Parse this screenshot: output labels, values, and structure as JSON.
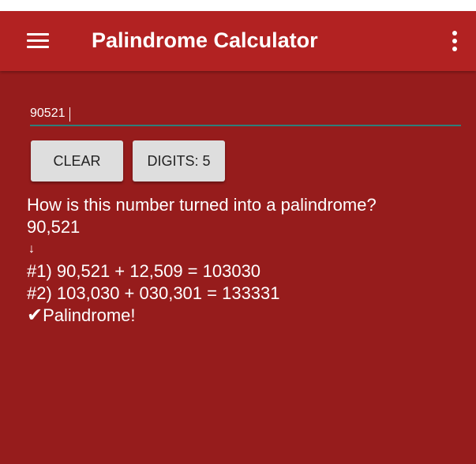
{
  "app_bar": {
    "menu_icon": "hamburger-menu-icon",
    "title": "Palindrome Calculator",
    "overflow_icon": "more-vertical-icon"
  },
  "input": {
    "value": "90521"
  },
  "buttons": {
    "clear_label": "CLEAR",
    "digits_label": "DIGITS: 5"
  },
  "result": {
    "question": "How is this number turned into a palindrome?",
    "start_number": "90,521",
    "arrow": "↓",
    "steps": [
      "#1) 90,521 + 12,509 = 103030",
      "#2) 103,030 + 030,301 = 133331"
    ],
    "check_mark": "✔",
    "conclusion": "Palindrome!"
  },
  "colors": {
    "app_bar": "#b22222",
    "background": "#961c1c",
    "input_underline": "#2e7f7a",
    "button": "#dedede"
  }
}
